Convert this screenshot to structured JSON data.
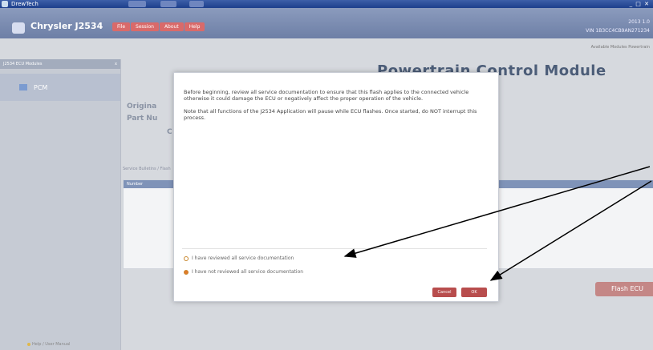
{
  "window": {
    "title": "DrewTech"
  },
  "header": {
    "app_name": "Chrysler J2534",
    "menu": [
      "File",
      "Session",
      "About",
      "Help"
    ],
    "vin_info": "VIN 1B3CC4CB9AN271234",
    "date_info": "2013 1.0"
  },
  "breadcrumb": "Available Modules  Powertrain",
  "sidebar": {
    "header": "J2534 ECU Modules",
    "close": "x",
    "items": [
      {
        "label": "PCM"
      }
    ],
    "footer": "Help / User Manual"
  },
  "main": {
    "module_title": "Powertrain Control Module",
    "info_labels": [
      "Origina",
      "Part Nu",
      "C"
    ],
    "section_label": "Service Bulletins / Flash",
    "table_header": "Number",
    "flash_button": "Flash ECU"
  },
  "dialog": {
    "paragraph1": "Before beginning, review all service documentation to ensure that this flash applies to the connected vehicle otherwise it could damage the ECU or negatively affect the proper operation of the vehicle.",
    "paragraph2": "Note that all functions of the J2534 Application will pause while ECU flashes. Once started, do NOT interrupt this process.",
    "options": [
      {
        "label": "I have reviewed all service documentation",
        "selected": false
      },
      {
        "label": "I have not reviewed all service documentation",
        "selected": true
      }
    ],
    "cancel_label": "Cancel",
    "ok_label": "OK"
  },
  "colors": {
    "accent": "#b84d4d",
    "header": "#8b9bbd",
    "radio_selected": "#e07a2a"
  }
}
